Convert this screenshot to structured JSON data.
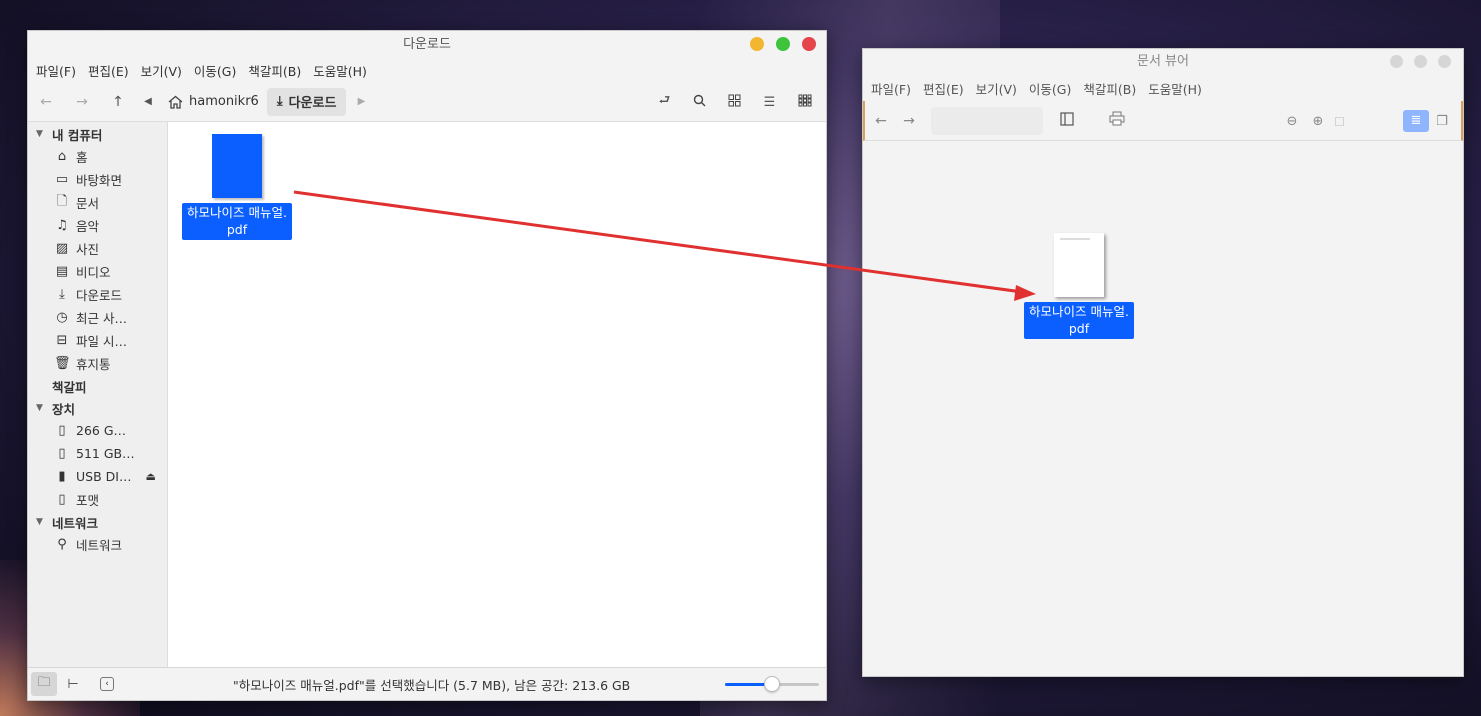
{
  "file_manager": {
    "title": "다운로드",
    "menu": [
      "파일(F)",
      "편집(E)",
      "보기(V)",
      "이동(G)",
      "책갈피(B)",
      "도움말(H)"
    ],
    "path": {
      "home": "hamonikr6",
      "current": "다운로드"
    },
    "sidebar": {
      "computer_header": "내 컴퓨터",
      "computer_items": [
        {
          "label": "홈",
          "icon": "home-icon"
        },
        {
          "label": "바탕화면",
          "icon": "desktop-icon"
        },
        {
          "label": "문서",
          "icon": "document-icon"
        },
        {
          "label": "음악",
          "icon": "music-icon"
        },
        {
          "label": "사진",
          "icon": "picture-icon"
        },
        {
          "label": "비디오",
          "icon": "video-icon"
        },
        {
          "label": "다운로드",
          "icon": "download-icon"
        },
        {
          "label": "최근 사…",
          "icon": "recent-icon"
        },
        {
          "label": "파일 시…",
          "icon": "filesystem-icon"
        },
        {
          "label": "휴지통",
          "icon": "trash-icon"
        }
      ],
      "bookmarks_header": "책갈피",
      "devices_header": "장치",
      "device_items": [
        {
          "label": "266 G…",
          "icon": "drive-icon"
        },
        {
          "label": "511 GB…",
          "icon": "drive-icon"
        },
        {
          "label": "USB DI…",
          "icon": "usb-icon"
        },
        {
          "label": "포맷",
          "icon": "drive-icon"
        }
      ],
      "network_header": "네트워크",
      "network_items": [
        {
          "label": "네트워크",
          "icon": "network-icon"
        }
      ]
    },
    "file": {
      "name": "하모나이즈 매뉴얼.\npdf"
    },
    "status": "\"하모나이즈 매뉴얼.pdf\"를 선택했습니다 (5.7 MB), 남은 공간: 213.6 GB",
    "zoom_level": 0.5
  },
  "doc_viewer": {
    "title": "문서 뷰어",
    "menu": [
      "파일(F)",
      "편집(E)",
      "보기(V)",
      "이동(G)",
      "책갈피(B)",
      "도움말(H)"
    ],
    "dropped_file": {
      "name": "하모나이즈 매뉴얼.\npdf"
    }
  },
  "colors": {
    "selection": "#0b5fff",
    "arrow": "#e03030"
  }
}
